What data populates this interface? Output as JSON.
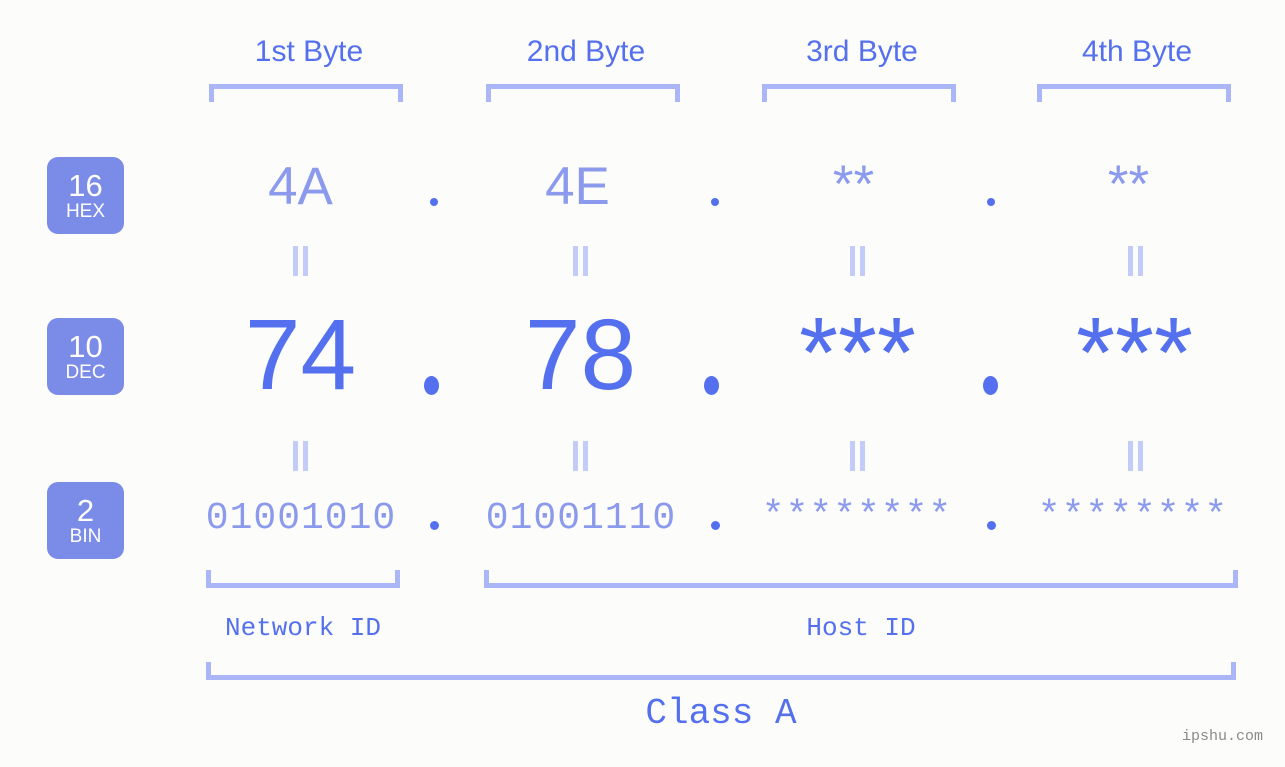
{
  "background_color": "#fcfdfa",
  "accent_color": "#5570ee",
  "muted_accent_color": "#8b9aed",
  "bracket_color": "#aab6f7",
  "badge_color": "#7b8ce8",
  "header": {
    "byte_labels": [
      {
        "text": "1st Byte"
      },
      {
        "text": "2nd Byte"
      },
      {
        "text": "3rd Byte"
      },
      {
        "text": "4th Byte"
      }
    ]
  },
  "rows": [
    {
      "id": "hex",
      "badge": {
        "number": "16",
        "name": "HEX"
      },
      "values": [
        "4A",
        "4E",
        "**",
        "**"
      ],
      "separator": "."
    },
    {
      "id": "dec",
      "badge": {
        "number": "10",
        "name": "DEC"
      },
      "values": [
        "74",
        "78",
        "***",
        "***"
      ],
      "separator": "."
    },
    {
      "id": "bin",
      "badge": {
        "number": "2",
        "name": "BIN"
      },
      "values": [
        "01001010",
        "01001110",
        "********",
        "********"
      ],
      "separator": "."
    }
  ],
  "equivalence_symbol": "=",
  "sections": {
    "network_id": "Network ID",
    "host_id": "Host ID",
    "class": "Class A"
  },
  "watermark": "ipshu.com"
}
